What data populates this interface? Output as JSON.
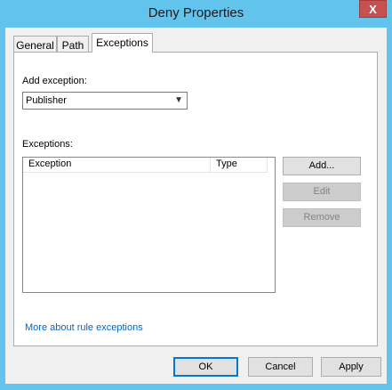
{
  "window": {
    "title": "Deny Properties",
    "close_glyph": "X"
  },
  "tabs": [
    {
      "label": "General"
    },
    {
      "label": "Path"
    },
    {
      "label": "Exceptions"
    }
  ],
  "exceptions_tab": {
    "add_exception_label": "Add exception:",
    "add_exception_value": "Publisher",
    "dropdown_arrow": "▼",
    "exceptions_label": "Exceptions:",
    "columns": [
      "Exception",
      "Type"
    ],
    "rows": [],
    "add_button": "Add...",
    "edit_button": "Edit",
    "remove_button": "Remove",
    "help_link": "More about rule exceptions"
  },
  "footer": {
    "ok": "OK",
    "cancel": "Cancel",
    "apply": "Apply"
  },
  "colors": {
    "titlebar": "#62c4ec",
    "close": "#c75050",
    "link": "#0066cc",
    "default_button_border": "#0078d7"
  }
}
